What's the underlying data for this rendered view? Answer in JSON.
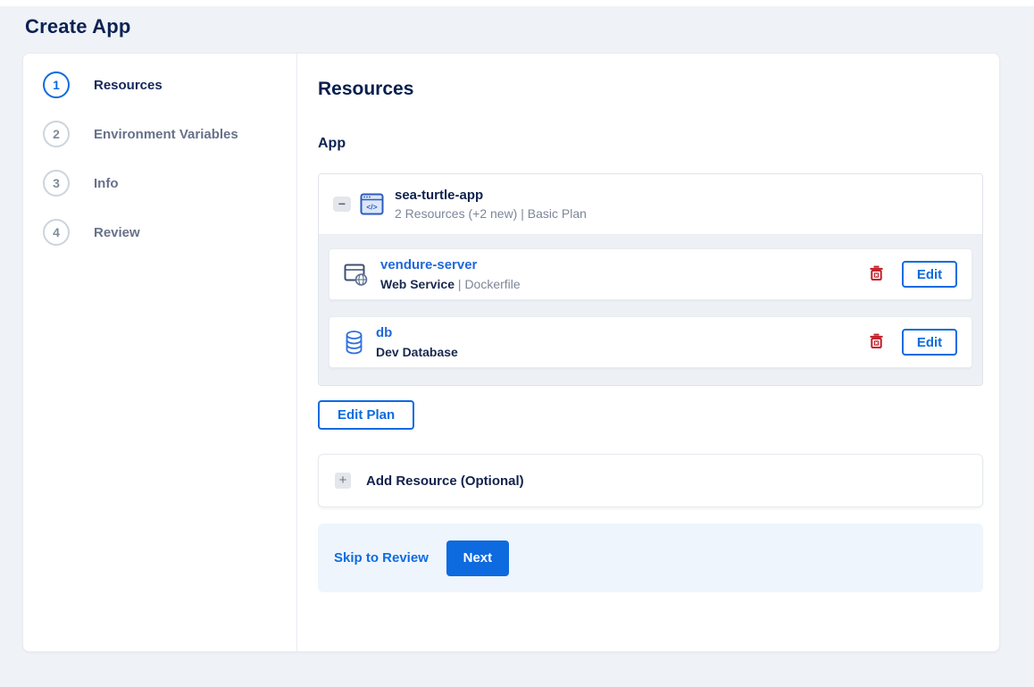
{
  "page": {
    "title": "Create App"
  },
  "colors": {
    "accent_blue": "#0d6be0",
    "navy_text": "#0b2253",
    "muted_text": "#7d8698",
    "danger_red": "#c11c26",
    "page_background": "#eff2f6",
    "footer_background": "#eff5fc",
    "panel_background": "#edf0f5"
  },
  "stepper": {
    "steps": [
      {
        "number": "1",
        "label": "Resources",
        "active": true
      },
      {
        "number": "2",
        "label": "Environment Variables",
        "active": false
      },
      {
        "number": "3",
        "label": "Info",
        "active": false
      },
      {
        "number": "4",
        "label": "Review",
        "active": false
      }
    ]
  },
  "main": {
    "heading": "Resources",
    "section_label": "App",
    "app": {
      "name": "sea-turtle-app",
      "summary": "2 Resources (+2 new) | Basic Plan",
      "collapse_glyph": "−",
      "resources": [
        {
          "name": "vendure-server",
          "type": "Web Service",
          "separator": "|",
          "detail": "Dockerfile",
          "edit_label": "Edit"
        },
        {
          "name": "db",
          "type": "Dev Database",
          "edit_label": "Edit"
        }
      ]
    },
    "edit_plan_label": "Edit Plan",
    "add_resource": {
      "label": "Add Resource (Optional)",
      "plus_glyph": "+"
    },
    "footer": {
      "skip_label": "Skip to Review",
      "next_label": "Next"
    }
  },
  "icons": {
    "code_glyph": "</>"
  }
}
